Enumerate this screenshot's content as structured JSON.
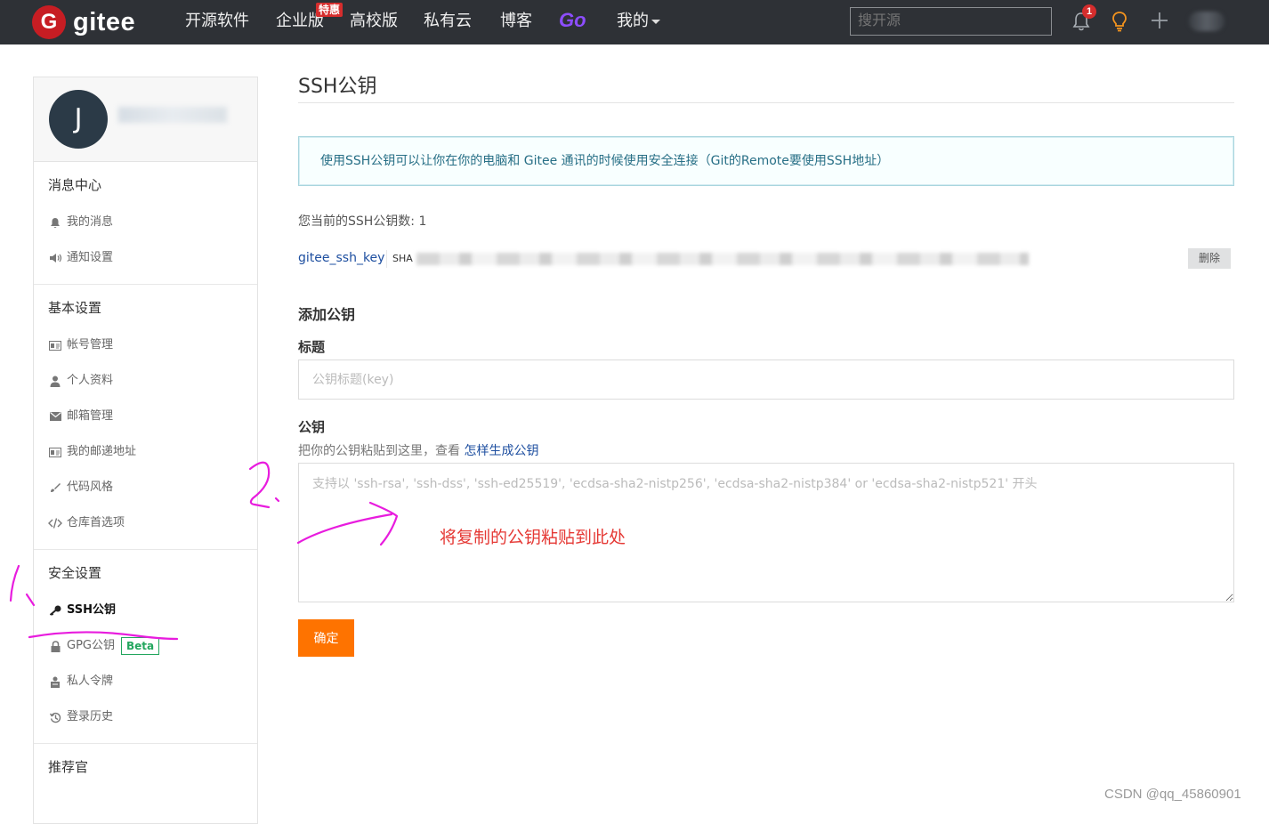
{
  "nav": {
    "logo_text": "gitee",
    "items": [
      "开源软件",
      "企业版",
      "高校版",
      "私有云",
      "博客"
    ],
    "badge": "特惠",
    "go_label": "Go",
    "mine_label": "我的",
    "search_placeholder": "搜开源",
    "notification_count": "1"
  },
  "sidebar": {
    "avatar_letter": "J",
    "groups": [
      {
        "title": "消息中心",
        "items": [
          {
            "label": "我的消息",
            "icon": "bell-icon"
          },
          {
            "label": "通知设置",
            "icon": "volume-icon"
          }
        ]
      },
      {
        "title": "基本设置",
        "items": [
          {
            "label": "帐号管理",
            "icon": "id-card-icon"
          },
          {
            "label": "个人资料",
            "icon": "user-icon"
          },
          {
            "label": "邮箱管理",
            "icon": "mail-icon"
          },
          {
            "label": "我的邮递地址",
            "icon": "address-card-icon"
          },
          {
            "label": "代码风格",
            "icon": "brush-icon"
          },
          {
            "label": "仓库首选项",
            "icon": "code-icon"
          }
        ]
      },
      {
        "title": "安全设置",
        "items": [
          {
            "label": "SSH公钥",
            "icon": "key-icon",
            "active": true
          },
          {
            "label": "GPG公钥",
            "icon": "lock-icon",
            "badge": "Beta"
          },
          {
            "label": "私人令牌",
            "icon": "token-icon"
          },
          {
            "label": "登录历史",
            "icon": "history-icon"
          }
        ]
      },
      {
        "title": "推荐官",
        "items": []
      }
    ]
  },
  "main": {
    "title": "SSH公钥",
    "info": "使用SSH公钥可以让你在你的电脑和 Gitee 通讯的时候使用安全连接（Git的Remote要使用SSH地址）",
    "key_count": "您当前的SSH公钥数: 1",
    "key": {
      "name": "gitee_ssh_key",
      "fingerprint_prefix": "SHA",
      "delete_label": "删除"
    },
    "add_heading": "添加公钥",
    "title_label": "标题",
    "title_placeholder": "公钥标题(key)",
    "key_label": "公钥",
    "key_hint": "把你的公钥粘贴到这里，查看",
    "key_hint_link": "怎样生成公钥",
    "key_placeholder": "支持以 'ssh-rsa', 'ssh-dss', 'ssh-ed25519', 'ecdsa-sha2-nistp256', 'ecdsa-sha2-nistp384' or 'ecdsa-sha2-nistp521' 开头",
    "submit_label": "确定"
  },
  "annotation": {
    "text": "将复制的公钥粘贴到此处",
    "color": "#e53935",
    "stroke_color": "#e81cde"
  },
  "watermark": "CSDN @qq_45860901",
  "colors": {
    "nav_bg": "#2e3136",
    "brand_red": "#c71d23",
    "accent_orange": "#fe7300",
    "link_blue": "#1e4fa0",
    "go_purple": "#8d4dff"
  }
}
